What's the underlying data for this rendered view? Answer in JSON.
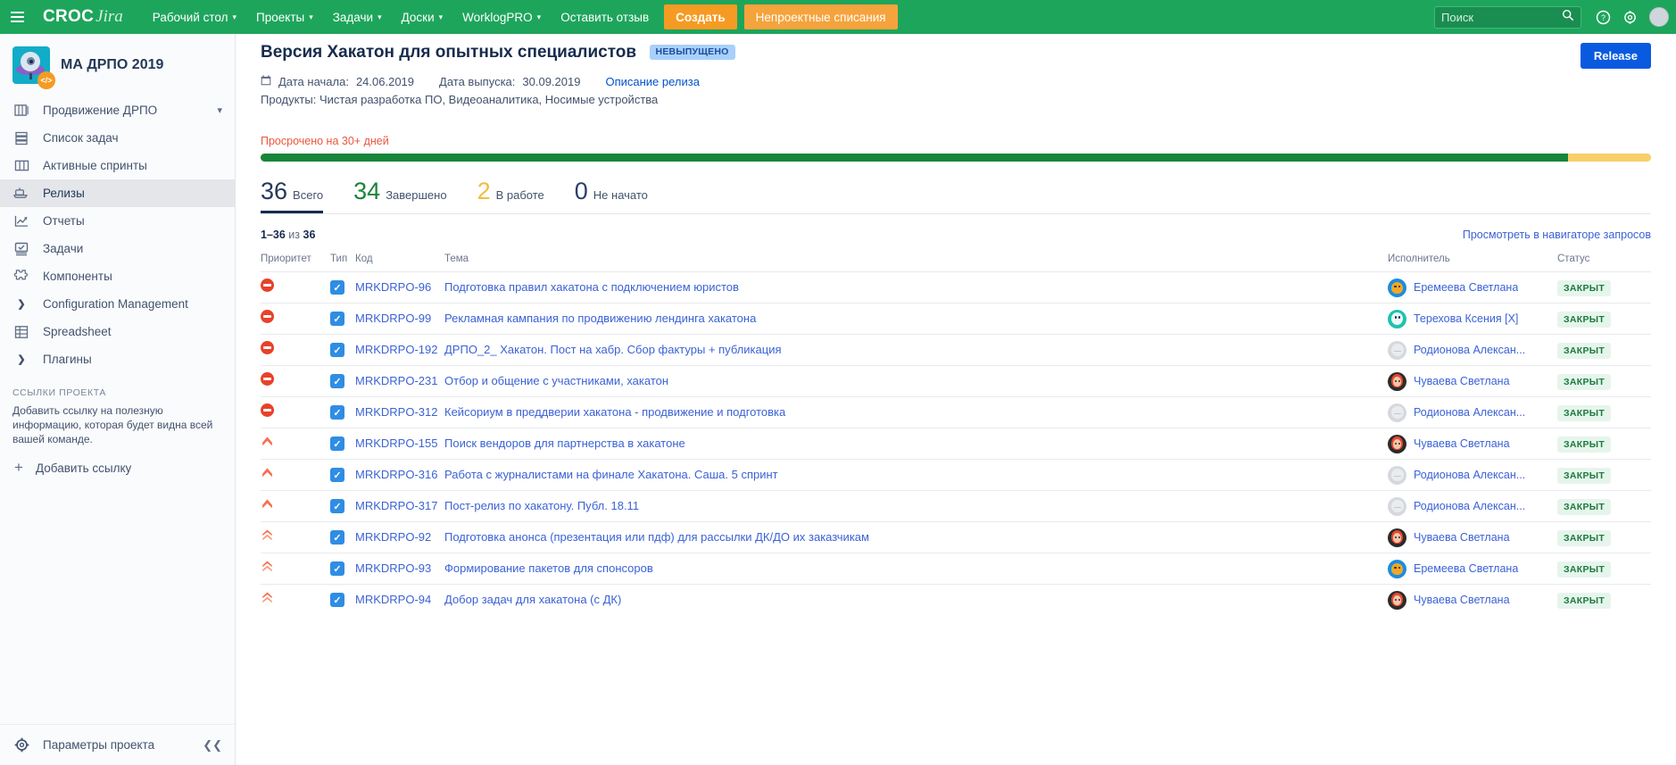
{
  "topnav": {
    "menu_icon": "hamburger-icon",
    "brand": {
      "primary": "CROC",
      "secondary": "Jira"
    },
    "items": [
      {
        "label": "Рабочий стол",
        "has_caret": true
      },
      {
        "label": "Проекты",
        "has_caret": true
      },
      {
        "label": "Задачи",
        "has_caret": true
      },
      {
        "label": "Доски",
        "has_caret": true
      },
      {
        "label": "WorklogPRO",
        "has_caret": true
      },
      {
        "label": "Оставить отзыв",
        "has_caret": false
      }
    ],
    "create_button": "Создать",
    "nonproject_button": "Непроектные списания",
    "search": {
      "placeholder": "Поиск",
      "value": "",
      "icon": "search-icon"
    },
    "help_icon": "help-icon",
    "settings_icon": "gear-icon",
    "profile_icon": "avatar"
  },
  "sidebar": {
    "project": {
      "name": "МА ДРПО 2019",
      "avatar_icon": "project-avatar-ufo",
      "badge_icon": "code-badge"
    },
    "items": [
      {
        "label": "Продвижение ДРПО",
        "icon": "board-icon",
        "type": "board",
        "active": false,
        "caret": true
      },
      {
        "label": "Список задач",
        "icon": "backlog-icon",
        "type": "nav",
        "active": false
      },
      {
        "label": "Активные спринты",
        "icon": "sprint-icon",
        "type": "nav",
        "active": false
      },
      {
        "label": "Релизы",
        "icon": "release-icon",
        "type": "nav",
        "active": true
      },
      {
        "label": "Отчеты",
        "icon": "reports-icon",
        "type": "nav",
        "active": false
      },
      {
        "label": "Задачи",
        "icon": "issues-icon",
        "type": "nav",
        "active": false
      },
      {
        "label": "Компоненты",
        "icon": "components-icon",
        "type": "nav",
        "active": false
      },
      {
        "label": "Configuration Management",
        "icon": "chevron-right-icon",
        "type": "expand",
        "active": false
      },
      {
        "label": "Spreadsheet",
        "icon": "spreadsheet-icon",
        "type": "nav",
        "active": false
      },
      {
        "label": "Плагины",
        "icon": "chevron-right-icon",
        "type": "expand",
        "active": false
      }
    ],
    "links_section": {
      "title": "ССЫЛКИ ПРОЕКТА",
      "description": "Добавить ссылку на полезную информацию, которая будет видна всей вашей команде.",
      "add_label": "Добавить ссылку"
    },
    "footer": {
      "label": "Параметры проекта",
      "icon": "gear-icon",
      "collapse_icon": "collapse-icon"
    }
  },
  "release": {
    "title": "Версия Хакатон для опытных специалистов",
    "status_badge": "НЕВЫПУЩЕНО",
    "release_button": "Release",
    "start_date_label": "Дата начала:",
    "start_date": "24.06.2019",
    "release_date_label": "Дата выпуска:",
    "release_date": "30.09.2019",
    "description_link": "Описание релиза",
    "products_label": "Продукты:",
    "products": "Чистая разработка ПО, Видеоаналитика, Носимые устройства",
    "overdue_text": "Просрочено на 30+ дней",
    "progress_percent": 94,
    "stats": [
      {
        "value": "36",
        "label": "Всего",
        "color": "#253858",
        "active": true
      },
      {
        "value": "34",
        "label": "Завершено",
        "color": "#1a8438",
        "active": false
      },
      {
        "value": "2",
        "label": "В работе",
        "color": "#f4bc3f",
        "active": false
      },
      {
        "value": "0",
        "label": "Не начато",
        "color": "#2c3e6b",
        "active": false
      }
    ]
  },
  "issue_list": {
    "count_prefix": "1–36",
    "count_middle": "из",
    "count_total": "36",
    "navigator_link": "Просмотреть в навигаторе запросов",
    "columns": [
      "Приоритет",
      "Тип",
      "Код",
      "Тема",
      "Исполнитель",
      "Статус"
    ],
    "rows": [
      {
        "priority": "blocker",
        "type": "task",
        "code": "MRKDRPO-96",
        "theme": "Подготовка правил хакатона с подключением юристов",
        "assignee": "Еремеева Светлана",
        "avatar": "av-cat",
        "status": "ЗАКРЫТ"
      },
      {
        "priority": "blocker",
        "type": "task",
        "code": "MRKDRPO-99",
        "theme": "Рекламная кампания по продвижению лендинга хакатона",
        "assignee": "Терехова Ксения [X]",
        "avatar": "av-teal",
        "status": "ЗАКРЫТ"
      },
      {
        "priority": "blocker",
        "type": "task",
        "code": "MRKDRPO-192",
        "theme": "ДРПО_2_ Хакатон. Пост на хабр. Сбор фактуры + публикация",
        "assignee": "Родионова Алексан...",
        "avatar": "av-grey",
        "status": "ЗАКРЫТ"
      },
      {
        "priority": "blocker",
        "type": "task",
        "code": "MRKDRPO-231",
        "theme": "Отбор и общение с участниками, хакатон",
        "assignee": "Чуваева Светлана",
        "avatar": "av-dark",
        "status": "ЗАКРЫТ"
      },
      {
        "priority": "blocker",
        "type": "task",
        "code": "MRKDRPO-312",
        "theme": "Кейсориум в преддверии хакатона - продвижение и подготовка",
        "assignee": "Родионова Алексан...",
        "avatar": "av-grey",
        "status": "ЗАКРЫТ"
      },
      {
        "priority": "critical",
        "type": "task",
        "code": "MRKDRPO-155",
        "theme": "Поиск вендоров для партнерства в хакатоне",
        "assignee": "Чуваева Светлана",
        "avatar": "av-dark",
        "status": "ЗАКРЫТ"
      },
      {
        "priority": "critical",
        "type": "task",
        "code": "MRKDRPO-316",
        "theme": "Работа с журналистами на финале Хакатона. Саша. 5 спринт",
        "assignee": "Родионова Алексан...",
        "avatar": "av-grey",
        "status": "ЗАКРЫТ"
      },
      {
        "priority": "critical",
        "type": "task",
        "code": "MRKDRPO-317",
        "theme": "Пост-релиз по хакатону. Публ. 18.11",
        "assignee": "Родионова Алексан...",
        "avatar": "av-grey",
        "status": "ЗАКРЫТ"
      },
      {
        "priority": "major",
        "type": "task",
        "code": "MRKDRPO-92",
        "theme": "Подготовка анонса (презентация или пдф) для рассылки ДК/ДО их заказчикам",
        "assignee": "Чуваева Светлана",
        "avatar": "av-dark",
        "status": "ЗАКРЫТ"
      },
      {
        "priority": "major",
        "type": "task",
        "code": "MRKDRPO-93",
        "theme": "Формирование пакетов для спонсоров",
        "assignee": "Еремеева Светлана",
        "avatar": "av-cat",
        "status": "ЗАКРЫТ"
      },
      {
        "priority": "major",
        "type": "task",
        "code": "MRKDRPO-94",
        "theme": "Добор задач для хакатона (с ДК)",
        "assignee": "Чуваева Светлана",
        "avatar": "av-dark",
        "status": "ЗАКРЫТ"
      }
    ]
  },
  "colors": {
    "nav_green": "#1ea55c",
    "orange": "#f59b23",
    "link_blue": "#3b62d6",
    "release_blue": "#0a5ae0",
    "progress_green": "#17853a",
    "progress_yellow": "#f9cf6a",
    "overdue_red": "#e8573f",
    "status_green": "#1c7a3e"
  }
}
